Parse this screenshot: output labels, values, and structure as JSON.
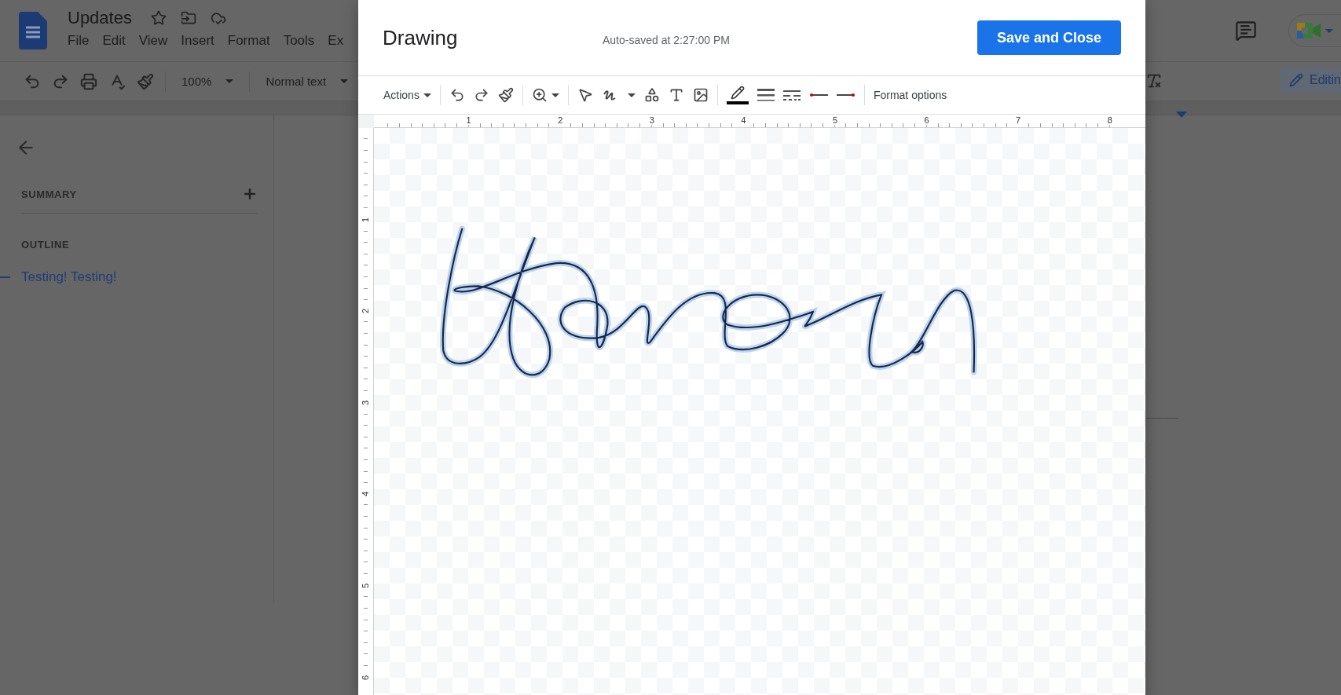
{
  "document": {
    "title": "Updates",
    "menu": [
      "File",
      "Edit",
      "View",
      "Insert",
      "Format",
      "Tools",
      "Ex"
    ],
    "toolbar": {
      "zoom": "100%",
      "style": "Normal text"
    },
    "editing_button": "Editin"
  },
  "sidebar": {
    "summary_label": "SUMMARY",
    "outline_label": "OUTLINE",
    "outline_items": [
      {
        "label": "Testing! Testing!",
        "selected": true
      }
    ]
  },
  "dialog": {
    "title": "Drawing",
    "autosave": "Auto-saved at 2:27:00 PM",
    "save_button": "Save and Close",
    "toolbar": {
      "actions": "Actions",
      "format_options": "Format options"
    },
    "ruler_horizontal": [
      "1",
      "2",
      "3",
      "4",
      "5",
      "6",
      "7",
      "8"
    ],
    "ruler_vertical": [
      "1",
      "2",
      "3",
      "4",
      "5",
      "6"
    ]
  }
}
